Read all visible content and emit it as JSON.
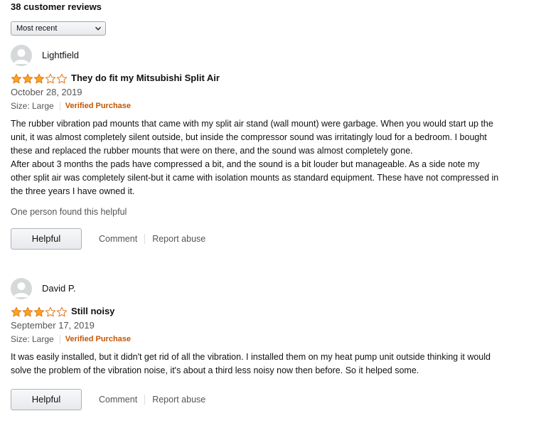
{
  "reviews_header": {
    "count_label": "38 customer reviews"
  },
  "sort": {
    "selected": "Most recent",
    "icon": "chevron-down-icon"
  },
  "colors": {
    "star_fill": "#ffa41c",
    "star_stroke": "#de7921",
    "verified": "#c45500",
    "muted_text": "#555555"
  },
  "reviews": [
    {
      "author": "Lightfield",
      "rating": 3,
      "max_rating": 5,
      "title": "They do fit my Mitsubishi Split Air",
      "date": "October 28, 2019",
      "size": "Size: Large",
      "verified": "Verified Purchase",
      "body": [
        "The rubber vibration pad mounts that came with my split air stand (wall mount) were garbage. When you would start up the unit, it was almost completely silent outside, but inside the compressor sound was irritatingly loud for a bedroom. I bought these and replaced the rubber mounts that were on there, and the sound was almost completely gone.",
        "After about 3 months the pads have compressed a bit, and the sound is a bit louder but manageable. As a side note my other split air was completely silent-but it came with isolation mounts as standard equipment. These have not compressed in the three years I have owned it."
      ],
      "helpful_count": "One person found this helpful",
      "helpful_button": "Helpful",
      "comment_link": "Comment",
      "report_link": "Report abuse"
    },
    {
      "author": "David P.",
      "rating": 3,
      "max_rating": 5,
      "title": "Still noisy",
      "date": "September 17, 2019",
      "size": "Size: Large",
      "verified": "Verified Purchase",
      "body": [
        "It was easily installed, but it didn't get rid of all the vibration. I installed them on my heat pump unit outside thinking it would solve the problem of the vibration noise, it's about a third less noisy now then before. So it helped some."
      ],
      "helpful_button": "Helpful",
      "comment_link": "Comment",
      "report_link": "Report abuse"
    }
  ]
}
